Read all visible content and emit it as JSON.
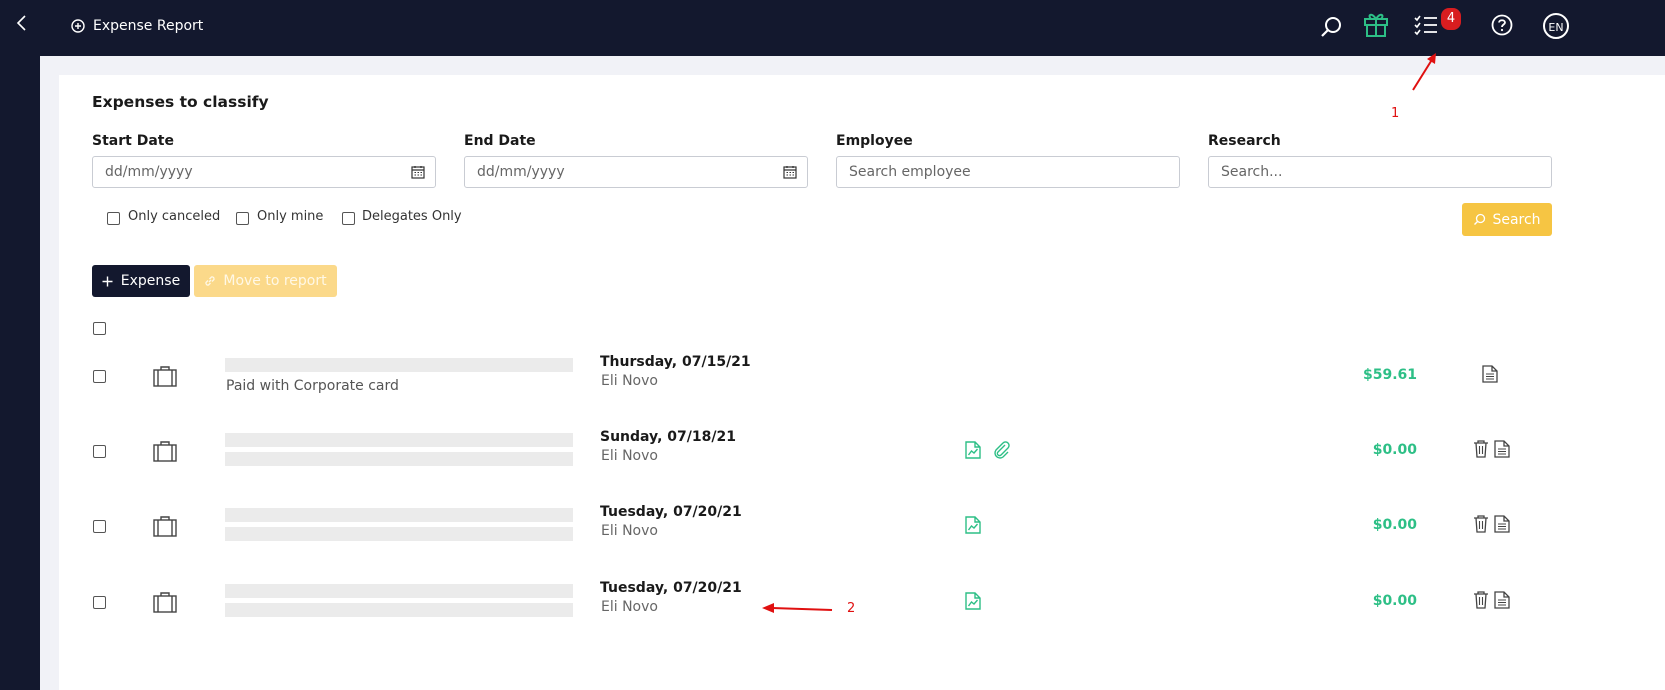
{
  "header": {
    "title": "Expense Report",
    "tasks_badge": "4",
    "language": "EN",
    "icons": [
      "back-chevron-icon",
      "add-circle-icon",
      "search-icon",
      "gift-icon",
      "tasks-checklist-icon",
      "help-icon"
    ]
  },
  "page": {
    "heading": "Expenses to classify",
    "filters": {
      "start_date_label": "Start Date",
      "start_date_placeholder": "dd/mm/yyyy",
      "end_date_label": "End Date",
      "end_date_placeholder": "dd/mm/yyyy",
      "employee_label": "Employee",
      "employee_placeholder": "Search employee",
      "research_label": "Research",
      "research_placeholder": "Search...",
      "only_canceled": "Only canceled",
      "only_mine": "Only mine",
      "delegates_only": "Delegates Only",
      "search_button": "Search"
    },
    "actions": {
      "add_expense": "Expense",
      "move_to_report": "Move to report"
    },
    "rows": [
      {
        "subtitle": "Paid with Corporate card",
        "date": "Thursday, 07/15/21",
        "employee": "Eli Novo",
        "amount": "$59.61",
        "receipt": false,
        "attachment": false,
        "delete": false
      },
      {
        "subtitle": "",
        "date": "Sunday, 07/18/21",
        "employee": "Eli Novo",
        "amount": "$0.00",
        "receipt": true,
        "attachment": true,
        "delete": true
      },
      {
        "subtitle": "",
        "date": "Tuesday, 07/20/21",
        "employee": "Eli Novo",
        "amount": "$0.00",
        "receipt": true,
        "attachment": false,
        "delete": true
      },
      {
        "subtitle": "",
        "date": "Tuesday, 07/20/21",
        "employee": "Eli Novo",
        "amount": "$0.00",
        "receipt": true,
        "attachment": false,
        "delete": true
      }
    ]
  },
  "annotations": {
    "marker_1": "1",
    "marker_2": "2"
  },
  "colors": {
    "nav_bg": "#13182e",
    "accent_yellow": "#f6c543",
    "amount_green": "#2dbf86",
    "badge_red": "#d81d20",
    "annotation_red": "#e01010"
  }
}
